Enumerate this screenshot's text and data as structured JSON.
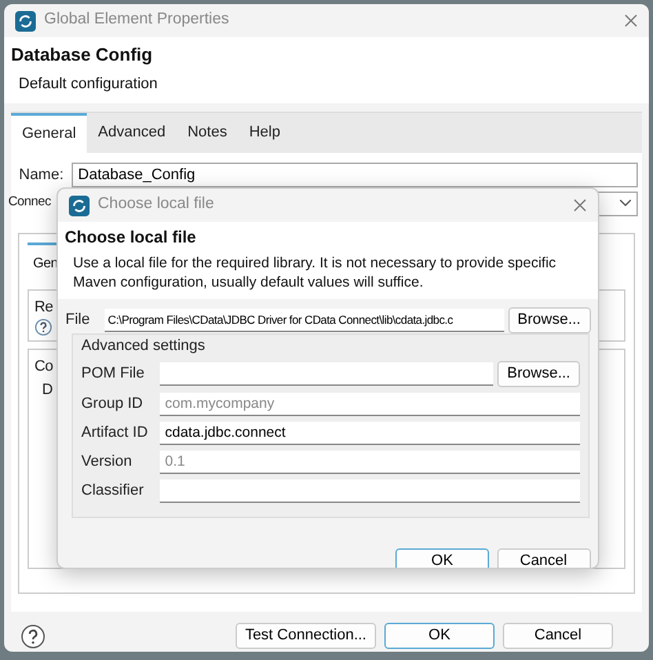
{
  "window": {
    "title": "Global Element Properties"
  },
  "header": {
    "title": "Database Config",
    "subtitle": "Default configuration"
  },
  "tabs": [
    {
      "label": "General",
      "selected": true
    },
    {
      "label": "Advanced",
      "selected": false
    },
    {
      "label": "Notes",
      "selected": false
    },
    {
      "label": "Help",
      "selected": false
    }
  ],
  "name_field": {
    "label": "Name:",
    "value": "Database_Config"
  },
  "connection_label": "Connec",
  "inner": {
    "tab": "Gen",
    "group_1": "Re",
    "group_2": "Co",
    "field_label": "D"
  },
  "footer_buttons": [
    {
      "label": "Test Connection...",
      "default": false
    },
    {
      "label": "OK",
      "default": true
    },
    {
      "label": "Cancel",
      "default": false
    }
  ],
  "dialog": {
    "title": "Choose local file",
    "heading": "Choose local file",
    "description": "Use a local file for the required library. It is not necessary to provide specific Maven configuration, usually default values will suffice.",
    "file": {
      "label": "File",
      "value": "C:\\Program Files\\CData\\JDBC Driver for CData Connect\\lib\\cdata.jdbc.c",
      "button": "Browse..."
    },
    "advanced_title": "Advanced settings",
    "fields": [
      {
        "label": "POM File",
        "button": "Browse..."
      },
      {
        "label": "Group ID",
        "placeholder": "com.mycompany"
      },
      {
        "label": "Artifact ID",
        "value": "cdata.jdbc.connect"
      },
      {
        "label": "Version",
        "placeholder": "0.1"
      },
      {
        "label": "Classifier"
      }
    ],
    "buttons": [
      {
        "label": "OK",
        "default": true
      },
      {
        "label": "Cancel",
        "default": false
      }
    ]
  }
}
